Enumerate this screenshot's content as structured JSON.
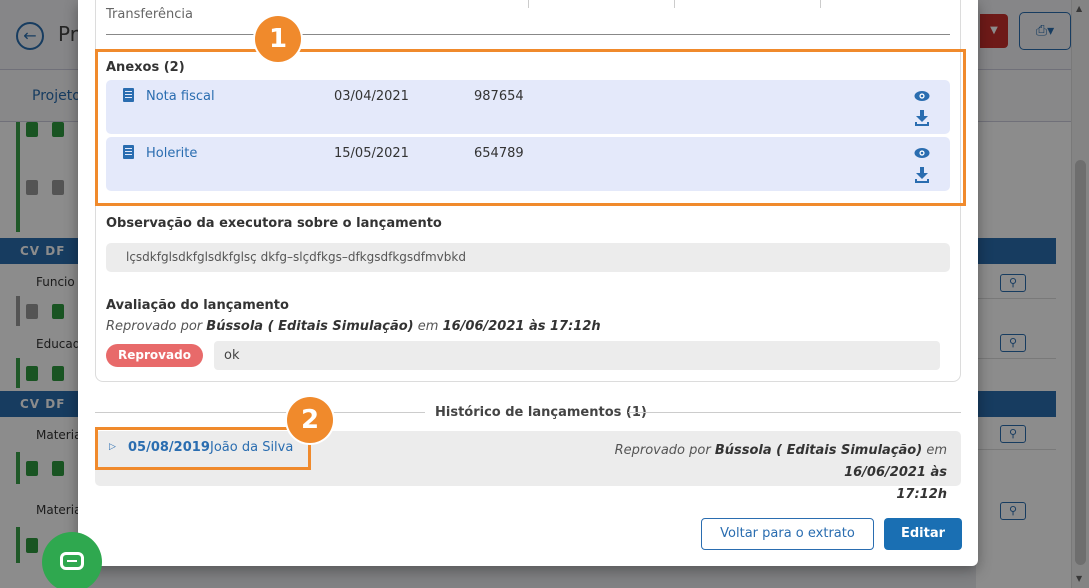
{
  "background": {
    "title": "Pr",
    "tab_label": "Projeto",
    "bars": [
      "CV  DF",
      "CV  DF"
    ],
    "row_labels": [
      "Funcio",
      "Educad",
      "Materia",
      "Materia"
    ]
  },
  "modal": {
    "top_row_label": "Transferência",
    "attachments": {
      "title": "Anexos (2)",
      "items": [
        {
          "name": "Nota fiscal",
          "date": "03/04/2021",
          "number": "987654"
        },
        {
          "name": "Holerite",
          "date": "15/05/2021",
          "number": "654789"
        }
      ]
    },
    "observation": {
      "title": "Observação da executora sobre o lançamento",
      "text": "lçsdkfglsdkfglsdkfglsç dkfg–slçdfkgs–dfkgsdfkgsdfmvbkd"
    },
    "evaluation": {
      "title": "Avaliação do lançamento",
      "prefix": "Reprovado por",
      "evaluator": "Bússola ( Editais Simulação)",
      "middle": "em",
      "datetime": "16/06/2021 às 17:12h",
      "badge": "Reprovado",
      "comment": "ok"
    },
    "history": {
      "title": "Histórico de lançamentos (1)",
      "entry": {
        "date": "05/08/2019",
        "user": "João da Silva",
        "status_prefix": "Reprovado por",
        "evaluator": "Bússola ( Editais Simulação)",
        "middle": "em",
        "datetime_1": "16/06/2021 às",
        "datetime_2": "17:12h"
      }
    },
    "buttons": {
      "back": "Voltar para o extrato",
      "edit": "Editar"
    }
  },
  "annotations": [
    "1",
    "2"
  ],
  "colors": {
    "accent": "#2a6db0",
    "callout": "#f08a2c",
    "reject_badge": "#e86a6a",
    "attachment_bg": "#e4e9fa"
  },
  "icons": [
    "back-arrow-icon",
    "print-icon",
    "document-icon",
    "eye-icon",
    "download-icon",
    "search-icon",
    "chat-icon",
    "caret-right-icon"
  ]
}
